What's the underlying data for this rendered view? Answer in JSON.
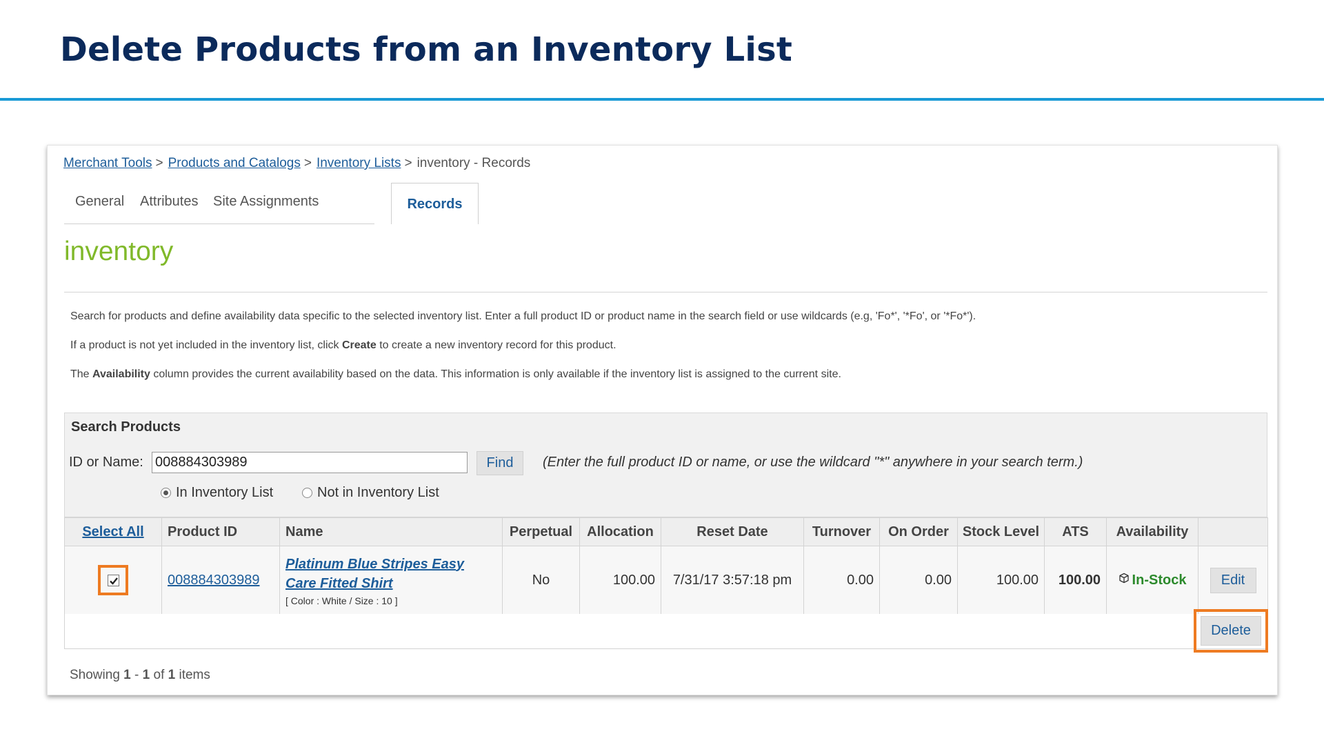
{
  "slide": {
    "title": "Delete Products from an Inventory List"
  },
  "breadcrumb": {
    "items": [
      "Merchant Tools",
      "Products and Catalogs",
      "Inventory Lists"
    ],
    "separator": ">",
    "current": "inventory - Records"
  },
  "tabs": [
    "General",
    "Attributes",
    "Site Assignments",
    "Records"
  ],
  "active_tab": "Records",
  "page_heading": "inventory",
  "info": {
    "line1": "Search for products and define availability data specific to the selected inventory list. Enter a full product ID or product name in the search field or use wildcards (e.g, 'Fo*', '*Fo', or '*Fo*').",
    "line2_pre": "If a product is not yet included in the inventory list, click ",
    "line2_bold": "Create",
    "line2_post": " to create a new inventory record for this product.",
    "line3_pre": "The ",
    "line3_bold": "Availability",
    "line3_post": " column provides the current availability based on the data. This information is only available if the inventory list is assigned to the current site."
  },
  "search": {
    "title": "Search Products",
    "label": "ID or Name:",
    "value": "008884303989",
    "find_label": "Find",
    "hint": "(Enter the full product ID or name, or use the wildcard \"*\" anywhere in your search term.)",
    "radio_in": "In Inventory List",
    "radio_out": "Not in Inventory List"
  },
  "table": {
    "headers": {
      "select_all": "Select All",
      "product_id": "Product ID",
      "name": "Name",
      "perpetual": "Perpetual",
      "allocation": "Allocation",
      "reset_date": "Reset Date",
      "turnover": "Turnover",
      "on_order": "On Order",
      "stock_level": "Stock Level",
      "ats": "ATS",
      "availability": "Availability"
    },
    "rows": [
      {
        "product_id": "008884303989",
        "name_line1": "Platinum Blue Stripes Easy",
        "name_line2": "Care Fitted Shirt",
        "variant": "[ Color :  White / Size :  10 ]",
        "perpetual": "No",
        "allocation": "100.00",
        "reset_date": "7/31/17 3:57:18 pm",
        "turnover": "0.00",
        "on_order": "0.00",
        "stock_level": "100.00",
        "ats": "100.00",
        "availability": "In-Stock",
        "edit_label": "Edit"
      }
    ]
  },
  "delete_label": "Delete",
  "showing": {
    "pre": "Showing ",
    "from": "1",
    "dash": " - ",
    "to": "1",
    "of": " of ",
    "total": "1",
    "post": " items"
  },
  "colors": {
    "title": "#0b2a5b",
    "rule": "#1a9ad6",
    "link": "#1d5d9a",
    "heading": "#80b92a",
    "highlight": "#ee7b22",
    "in_stock": "#2c8a2c"
  },
  "icons": {
    "availability": "package-icon",
    "checkbox": "checkmark-icon"
  }
}
